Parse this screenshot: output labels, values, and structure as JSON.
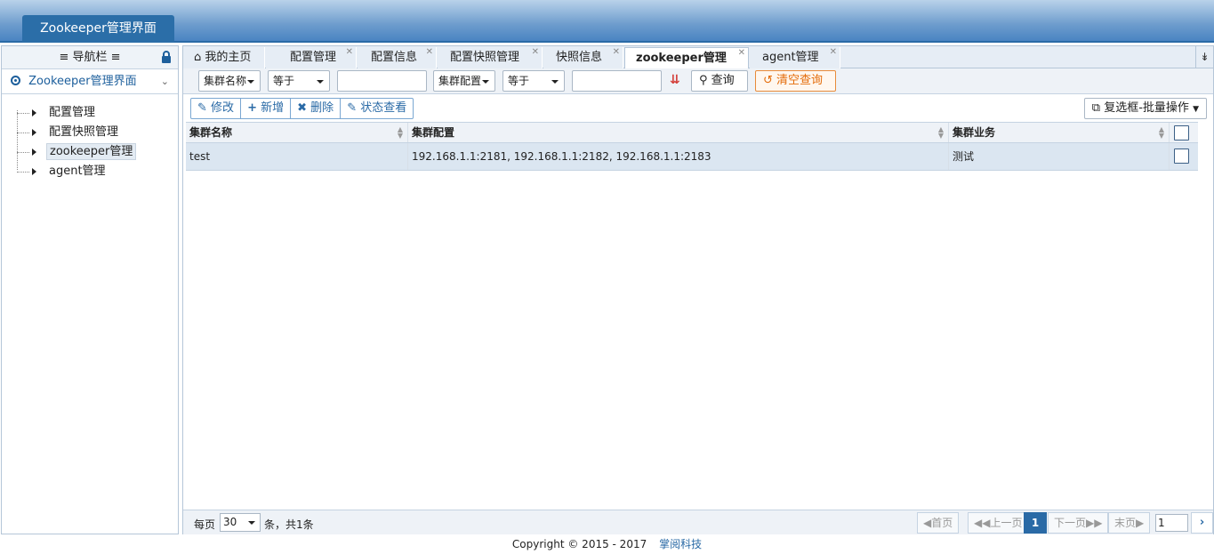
{
  "app": {
    "title": "Zookeeper管理界面"
  },
  "sidebar": {
    "header": "≡ 导航栏 ≡",
    "section": "Zookeeper管理界面",
    "items": [
      {
        "label": "配置管理"
      },
      {
        "label": "配置快照管理"
      },
      {
        "label": "zookeeper管理"
      },
      {
        "label": "agent管理"
      }
    ]
  },
  "tabs": [
    {
      "label": "我的主页",
      "icon": "home-icon"
    },
    {
      "label": "配置管理"
    },
    {
      "label": "配置信息"
    },
    {
      "label": "配置快照管理"
    },
    {
      "label": "快照信息"
    },
    {
      "label": "zookeeper管理",
      "active": true
    },
    {
      "label": "agent管理"
    }
  ],
  "filter": {
    "field1": "集群名称",
    "op1": "等于",
    "field2": "集群配置",
    "op2": "等于",
    "search_label": "查询",
    "clear_label": "清空查询"
  },
  "toolbar": {
    "edit": "修改",
    "add": "新增",
    "delete": "删除",
    "status": "状态查看",
    "batch": "复选框-批量操作"
  },
  "grid": {
    "columns": [
      "集群名称",
      "集群配置",
      "集群业务"
    ],
    "rows": [
      {
        "name": "test",
        "config": "192.168.1.1:2181, 192.168.1.1:2182, 192.168.1.1:2183",
        "business": "测试"
      }
    ]
  },
  "pager": {
    "per_page_label": "每页",
    "per_page": "30",
    "info": "条，共1条",
    "first": "首页",
    "prev": "上一页",
    "current": "1",
    "next": "下一页",
    "last": "末页",
    "page_input": "1"
  },
  "footer": {
    "copyright": "Copyright © 2015 - 2017",
    "brand": "掌阅科技"
  },
  "colors": {
    "accent": "#2a6aa6",
    "warn": "#e46c0a",
    "row_selected": "#dbe6f1"
  }
}
